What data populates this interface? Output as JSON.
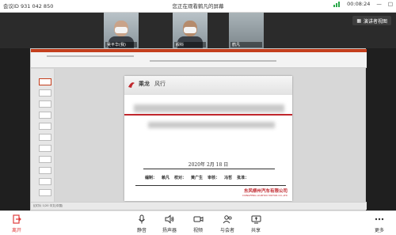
{
  "titlebar": {
    "meeting_id": "会议ID 931 042 850",
    "viewing": "您正在观看鹤凡的屏幕",
    "timer": "00:08:24"
  },
  "participants": [
    {
      "name": "吴平华(我)"
    },
    {
      "name": "舰科"
    },
    {
      "name": "鹤凡"
    }
  ],
  "strip": {
    "speaker_view_label": "演讲者视图"
  },
  "slide": {
    "brand": "乘龙",
    "tagline": "风行",
    "date": "2020年 2月 18 日",
    "sign_fields": [
      "编制：",
      "赖凡",
      "校对：",
      "黄广生",
      "审核：",
      "冯哲",
      "批准："
    ],
    "company": "东风柳州汽车有限公司",
    "company_en": "DONGFENG LIUZHOU MOTOR CO.,LTD"
  },
  "share_status": "幻灯片 1/20 中文(中国)",
  "toolbar": {
    "leave": "离开",
    "mute": "静音",
    "speaker": "扬声器",
    "video": "视频",
    "participants": "与会者",
    "share": "共享",
    "more": "更多"
  },
  "colors": {
    "accent_red": "#c0272d",
    "signal_green": "#2aa84a",
    "leave_red": "#e03c3c"
  }
}
